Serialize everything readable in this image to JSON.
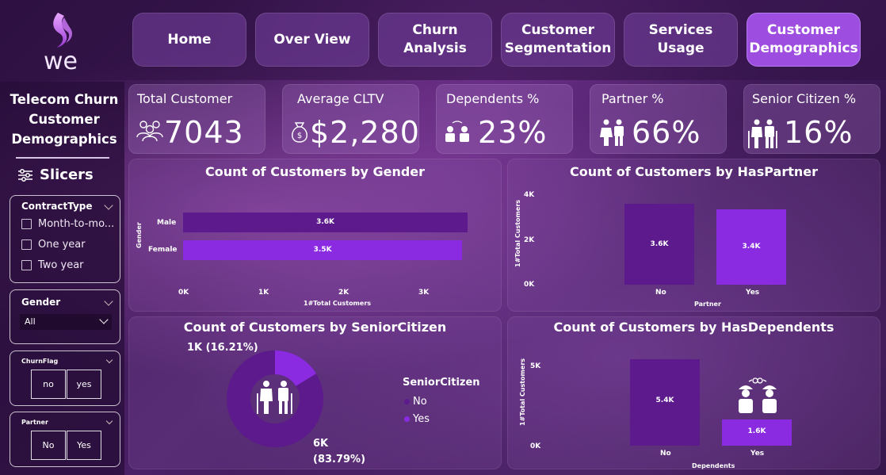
{
  "brand": {
    "logo_text": "we"
  },
  "nav": [
    {
      "label": "Home",
      "active": false
    },
    {
      "label": "Over View",
      "active": false
    },
    {
      "label": "Churn Analysis",
      "active": false
    },
    {
      "label": "Customer Segmentation",
      "active": false
    },
    {
      "label": "Services Usage",
      "active": false
    },
    {
      "label": "Customer Demographics",
      "active": true
    }
  ],
  "sidebar": {
    "title": "Telecom Churn Customer Demographics",
    "slicers_label": "Slicers",
    "contract": {
      "title": "ContractType",
      "options": [
        "Month-to-mo...",
        "One year",
        "Two year"
      ]
    },
    "gender": {
      "title": "Gender",
      "value": "All"
    },
    "churn": {
      "title": "ChurnFlag",
      "buttons": [
        "no",
        "yes"
      ]
    },
    "partner": {
      "title": "Partner",
      "buttons": [
        "No",
        "Yes"
      ]
    }
  },
  "kpis": [
    {
      "label": "Total Customer",
      "value": "7043",
      "icon": "people-group-icon"
    },
    {
      "label": "Average CLTV",
      "value": "$2,280",
      "icon": "money-bag-icon"
    },
    {
      "label": "Dependents %",
      "value": "23%",
      "icon": "dependents-icon"
    },
    {
      "label": "Partner %",
      "value": "66%",
      "icon": "couple-icon"
    },
    {
      "label": "Senior Citizen %",
      "value": "16%",
      "icon": "senior-couple-icon"
    }
  ],
  "colors": {
    "dark_bar": "#5c1a8c",
    "light_bar": "#8a2be2",
    "active_nav": "#9d4ee0"
  },
  "chart_data": [
    {
      "type": "bar",
      "orientation": "horizontal",
      "title": "Count of Customers by Gender",
      "categories": [
        "Male",
        "Female"
      ],
      "values": [
        3555,
        3488
      ],
      "data_labels": [
        "3.6K",
        "3.5K"
      ],
      "xlabel": "1#Total Customers",
      "ylabel": "Gender",
      "xticks": [
        "0K",
        "1K",
        "2K",
        "3K"
      ],
      "xlim": [
        0,
        3800
      ]
    },
    {
      "type": "bar",
      "title": "Count of Customers by HasPartner",
      "categories": [
        "No",
        "Yes"
      ],
      "values": [
        3641,
        3402
      ],
      "data_labels": [
        "3.6K",
        "3.4K"
      ],
      "xlabel": "Partner",
      "ylabel": "1#Total Customers",
      "yticks": [
        "0K",
        "2K",
        "4K"
      ],
      "ylim": [
        0,
        4000
      ]
    },
    {
      "type": "pie",
      "title": "Count of Customers by SeniorCitizen",
      "legend_title": "SeniorCitizen",
      "categories": [
        "No",
        "Yes"
      ],
      "values": [
        5901,
        1142
      ],
      "data_labels": [
        "6K (83.79%)",
        "1K (16.21%)"
      ],
      "legend_position": "right"
    },
    {
      "type": "bar",
      "title": "Count of Customers by HasDependents",
      "categories": [
        "No",
        "Yes"
      ],
      "values": [
        5416,
        1627
      ],
      "data_labels": [
        "5.4K",
        "1.6K"
      ],
      "xlabel": "Dependents",
      "ylabel": "1#Total Customers",
      "yticks": [
        "0K",
        "5K"
      ],
      "ylim": [
        0,
        5500
      ]
    }
  ]
}
